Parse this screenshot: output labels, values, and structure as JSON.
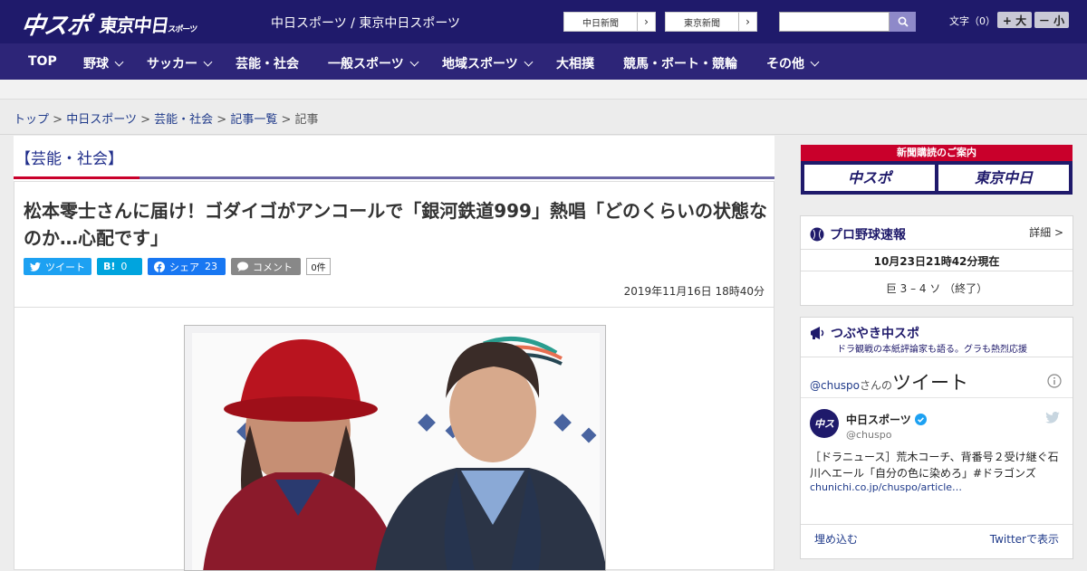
{
  "header": {
    "logo_main": "中スポ",
    "logo_tokyo": "東京中日",
    "logo_tokyo_small": "スポーツ",
    "tagline": "中日スポーツ / 東京中日スポーツ",
    "paper_links": [
      "中日新聞",
      "東京新聞"
    ],
    "search_placeholder": "",
    "font_label": "文字（0）",
    "font_larger": "+ 大",
    "font_smaller": "－ 小"
  },
  "nav": [
    {
      "label": "TOP",
      "dropdown": false
    },
    {
      "label": "野球",
      "dropdown": true
    },
    {
      "label": "サッカー",
      "dropdown": true
    },
    {
      "label": "芸能・社会",
      "dropdown": false
    },
    {
      "label": "一般スポーツ",
      "dropdown": true
    },
    {
      "label": "地域スポーツ",
      "dropdown": true
    },
    {
      "label": "大相撲",
      "dropdown": false
    },
    {
      "label": "競馬・ボート・競輪",
      "dropdown": false
    },
    {
      "label": "その他",
      "dropdown": true
    }
  ],
  "breadcrumb": {
    "items": [
      "トップ",
      "中日スポーツ",
      "芸能・社会",
      "記事一覧"
    ],
    "current": "記事",
    "separator": ">"
  },
  "article": {
    "category": "【芸能・社会】",
    "title": "松本零士さんに届け！ゴダイゴがアンコールで「銀河鉄道999」熱唱「どのくらいの状態なのか…心配です」",
    "share": {
      "tweet": "ツイート",
      "hatena": "B!",
      "hatena_count": "0",
      "facebook": "シェア",
      "facebook_count": "23",
      "comment": "コメント",
      "comment_count": "0件"
    },
    "date": "2019年11月16日 18時40分"
  },
  "sidebar": {
    "subscribe_title": "新聞購読のご案内",
    "subscribe_logos": [
      "中スポ",
      "東京中日"
    ],
    "baseball": {
      "title": "プロ野球速報",
      "detail": "詳細 >",
      "timestamp": "10月23日21時42分現在",
      "score": "巨 3 – 4 ソ （終了）"
    },
    "tweets": {
      "title": "つぶやき中スポ",
      "subtitle": "ドラ観戦の本紙評論家も語る。グラも熱烈応援",
      "handle_line_user": "@chuspo",
      "handle_line_san": "さんの",
      "handle_line_tweet": "ツイート",
      "author": "中日スポーツ",
      "author_handle": "@chuspo",
      "tweet_text": "［ドラニュース］荒木コーチ、背番号２受け継ぐ石川へエール「自分の色に染めろ」#ドラゴンズ",
      "tweet_link": "chunichi.co.jp/chuspo/article…",
      "embed": "埋め込む",
      "view_on": "Twitterで表示"
    }
  },
  "colors": {
    "header_bg": "#1f1a6b",
    "nav_bg": "#2d2578",
    "accent_red": "#c9002b",
    "twitter": "#1da1f2",
    "hatena": "#00a4de",
    "facebook": "#1877f2"
  }
}
